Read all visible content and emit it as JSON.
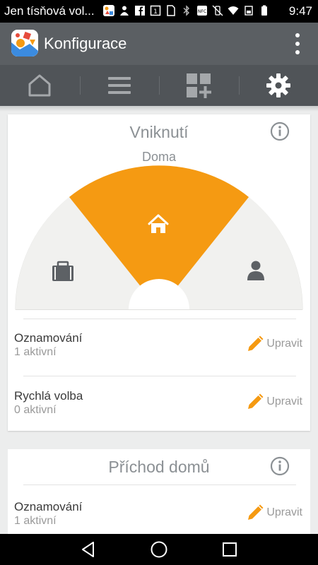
{
  "status_bar": {
    "carrier_text": "Jen tísňová vol...",
    "time": "9:47",
    "icons": [
      "app-notification-icon",
      "person-icon",
      "facebook-icon",
      "notification-icon",
      "sim-icon",
      "bluetooth-icon",
      "nfc-icon",
      "vibrate-icon",
      "wifi-icon",
      "battery-saver-icon",
      "battery-icon"
    ]
  },
  "app_bar": {
    "title": "Konfigurace",
    "menu_icon": "more-vert-icon"
  },
  "tabs": [
    {
      "icon": "home-icon",
      "active": false
    },
    {
      "icon": "list-icon",
      "active": false
    },
    {
      "icon": "add-widget-icon",
      "active": false
    },
    {
      "icon": "gear-icon",
      "active": true
    }
  ],
  "intrusion_card": {
    "title": "Vniknutí",
    "mode_label": "Doma",
    "modes": [
      {
        "icon": "briefcase-icon",
        "selected": false
      },
      {
        "icon": "home-icon",
        "selected": true
      },
      {
        "icon": "person-icon",
        "selected": false
      }
    ],
    "rows": [
      {
        "title": "Oznamování",
        "subtitle": "1 aktivní",
        "action": "Upravit"
      },
      {
        "title": "Rychlá volba",
        "subtitle": "0 aktivní",
        "action": "Upravit"
      }
    ]
  },
  "arrival_card": {
    "title": "Příchod domů",
    "rows": [
      {
        "title": "Oznamování",
        "subtitle": "1 aktivní",
        "action": "Upravit"
      }
    ]
  },
  "colors": {
    "accent": "#f59a12",
    "app_bar": "#5b5f63",
    "tab_bar": "#505458",
    "gauge_bg": "#f1f1ef"
  },
  "nav_bar": {
    "buttons": [
      "back-icon",
      "home-circle-icon",
      "recents-icon"
    ]
  }
}
